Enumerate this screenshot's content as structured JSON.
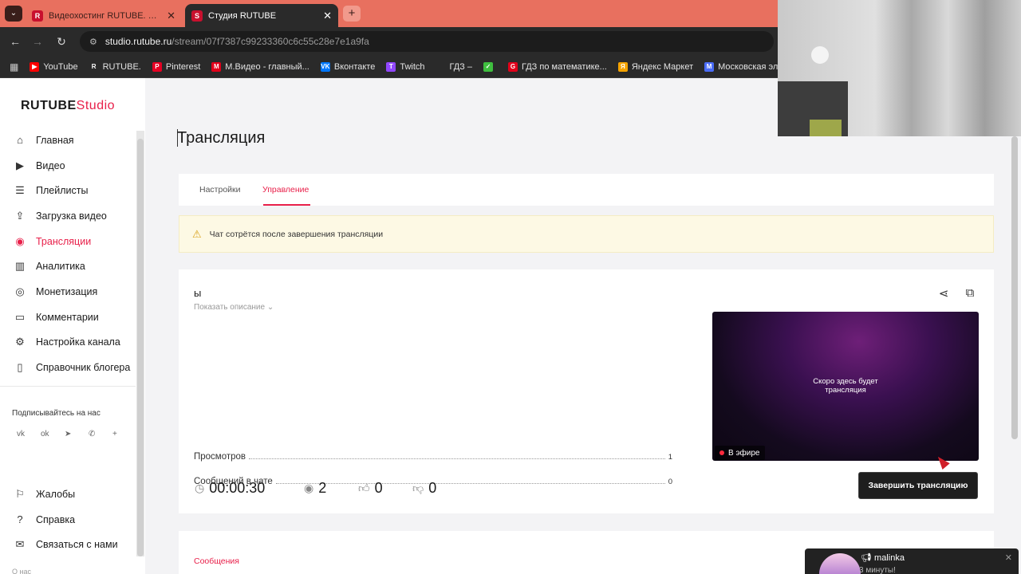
{
  "browser": {
    "tabs": [
      {
        "favicon": "R",
        "title": "Видеохостинг RUTUBE. Смотр"
      },
      {
        "favicon": "S",
        "title": "Студия RUTUBE"
      }
    ],
    "url_host": "studio.rutube.ru",
    "url_path": "/stream/07f7387c99233360c6c55c28e7e1a9fa",
    "bookmarks": [
      {
        "label": "YouTube",
        "color": "#ff0000",
        "icon": "▶"
      },
      {
        "label": "RUTUBE.",
        "color": "#2a2a2a",
        "icon": "R"
      },
      {
        "label": "Pinterest",
        "color": "#e60023",
        "icon": "P"
      },
      {
        "label": "М.Видео - главный...",
        "color": "#e2001a",
        "icon": "М"
      },
      {
        "label": "Вконтакте",
        "color": "#0077ff",
        "icon": "VK"
      },
      {
        "label": "Twitch",
        "color": "#9146ff",
        "icon": "T"
      },
      {
        "label": "ГДЗ –",
        "color": "#2a2a2a",
        "icon": ""
      },
      {
        "label": "",
        "color": "#3fbf3f",
        "icon": "✓"
      },
      {
        "label": "ГДЗ по математике...",
        "color": "#e2001a",
        "icon": "G"
      },
      {
        "label": "Яндекс Маркет",
        "color": "#f5a300",
        "icon": "Я"
      },
      {
        "label": "Московская электр...",
        "color": "#4a6cf7",
        "icon": "М"
      }
    ]
  },
  "sidebar": {
    "logo_main": "RUTUBE",
    "logo_studio": "Studio",
    "items": [
      {
        "label": "Главная",
        "icon": "home-icon",
        "glyph": "⌂"
      },
      {
        "label": "Видео",
        "icon": "video-icon",
        "glyph": "▶"
      },
      {
        "label": "Плейлисты",
        "icon": "playlist-icon",
        "glyph": "☰"
      },
      {
        "label": "Загрузка видео",
        "icon": "upload-icon",
        "glyph": "⇪"
      },
      {
        "label": "Трансляции",
        "icon": "broadcast-icon",
        "glyph": "◉"
      },
      {
        "label": "Аналитика",
        "icon": "analytics-icon",
        "glyph": "▥"
      },
      {
        "label": "Монетизация",
        "icon": "money-icon",
        "glyph": "◎"
      },
      {
        "label": "Комментарии",
        "icon": "comment-icon",
        "glyph": "▭"
      },
      {
        "label": "Настройка канала",
        "icon": "gear-icon",
        "glyph": "⚙"
      },
      {
        "label": "Справочник блогера",
        "icon": "book-icon",
        "glyph": "▯"
      }
    ],
    "follow_label": "Подписывайтесь на нас",
    "socials": [
      {
        "icon": "vk-icon",
        "glyph": "vk"
      },
      {
        "icon": "ok-icon",
        "glyph": "ok"
      },
      {
        "icon": "telegram-icon",
        "glyph": "➤"
      },
      {
        "icon": "viber-icon",
        "glyph": "✆"
      },
      {
        "icon": "plus-icon",
        "glyph": "+"
      }
    ],
    "bottom_items": [
      {
        "label": "Жалобы",
        "icon": "flag-icon",
        "glyph": "⚐"
      },
      {
        "label": "Справка",
        "icon": "help-icon",
        "glyph": "?"
      },
      {
        "label": "Связаться с нами",
        "icon": "mail-icon",
        "glyph": "✉"
      }
    ],
    "footnote": "О нас"
  },
  "main": {
    "title": "Трансляция",
    "tabs": [
      {
        "label": "Настройки"
      },
      {
        "label": "Управление"
      }
    ],
    "active_tab": "Управление",
    "warning": "Чат сотрётся после завершения трансляции",
    "stream": {
      "title": "ы",
      "show_description": "Показать описание",
      "stats": [
        {
          "label": "Просмотров",
          "value": "1"
        },
        {
          "label": "Сообщений в чате",
          "value": "0"
        }
      ],
      "preview_text_line1": "Скоро здесь будет",
      "preview_text_line2": "трансляция",
      "live_label": "В эфире",
      "end_button": "Завершить трансляцию",
      "duration": "00:00:30",
      "viewers": "2",
      "likes": "0",
      "dislikes": "0"
    },
    "messages_title": "Сообщения"
  },
  "notification": {
    "name": "malinka",
    "subtitle": "3 минуты!"
  },
  "colors": {
    "accent": "#e8204a",
    "tabbar": "#e8705f",
    "chrome": "#2a2a2a"
  }
}
